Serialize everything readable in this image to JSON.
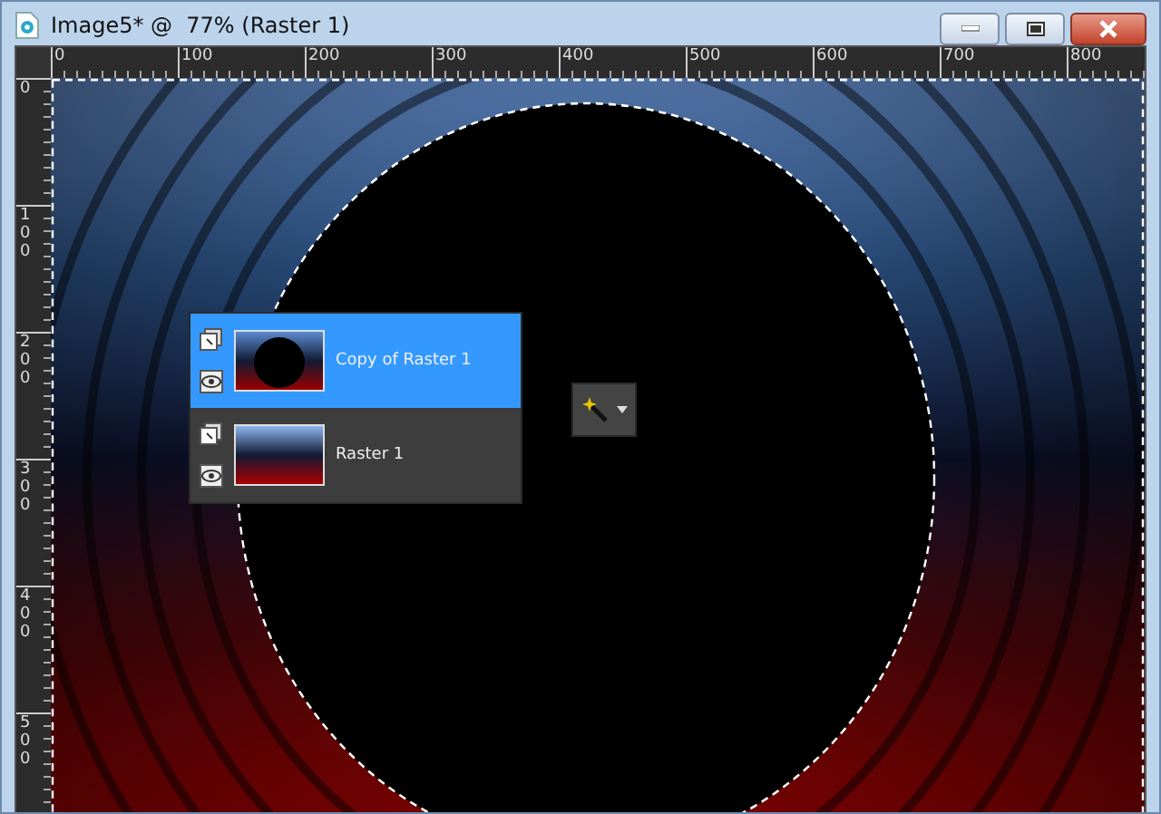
{
  "window": {
    "title": "Image5* @  77% (Raster 1)"
  },
  "rulers": {
    "horizontal": [
      "0",
      "100",
      "200",
      "300",
      "400",
      "500",
      "600",
      "700",
      "800"
    ],
    "vertical": [
      "0",
      "100",
      "200",
      "300",
      "400",
      "500"
    ]
  },
  "layers": [
    {
      "name": "Copy of Raster 1",
      "kind": "circle",
      "selected": true
    },
    {
      "name": "Raster 1",
      "kind": "gradient",
      "selected": false
    }
  ]
}
